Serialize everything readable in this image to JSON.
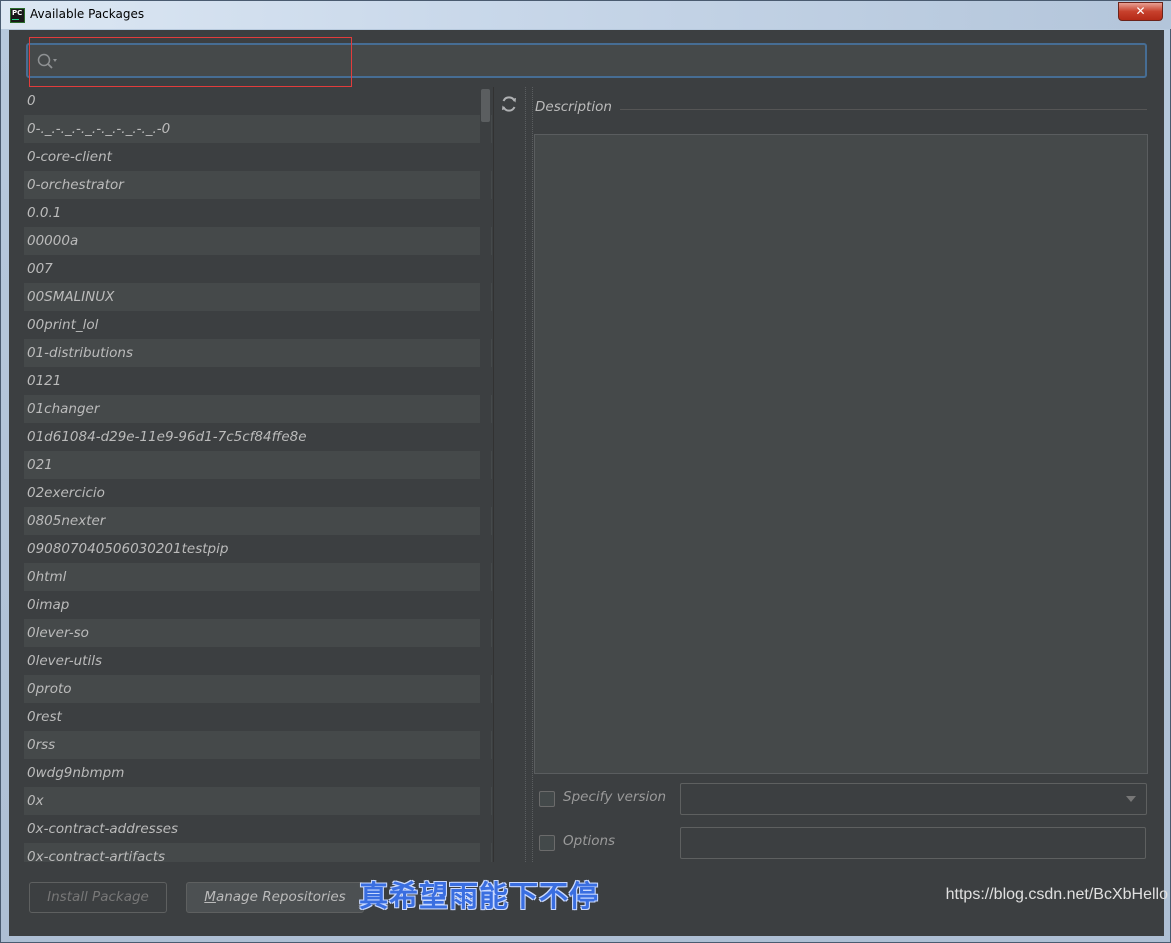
{
  "window": {
    "title": "Available Packages",
    "app_icon_text": "PC",
    "close_glyph": "✕"
  },
  "search": {
    "placeholder": "",
    "value": ""
  },
  "packages": [
    "0",
    "0-._.-._.-._.-._.-._.-._.-0",
    "0-core-client",
    "0-orchestrator",
    "0.0.1",
    "00000a",
    "007",
    "00SMALINUX",
    "00print_lol",
    "01-distributions",
    "0121",
    "01changer",
    "01d61084-d29e-11e9-96d1-7c5cf84ffe8e",
    "021",
    "02exercicio",
    "0805nexter",
    "090807040506030201testpip",
    "0html",
    "0imap",
    "0lever-so",
    "0lever-utils",
    "0proto",
    "0rest",
    "0rss",
    "0wdg9nbmpm",
    "0x",
    "0x-contract-addresses",
    "0x-contract-artifacts"
  ],
  "description": {
    "label": "Description",
    "text": ""
  },
  "options": {
    "specify_version_label": "Specify version",
    "options_label": "Options",
    "version_value": "",
    "options_value": ""
  },
  "buttons": {
    "install": "Install Package",
    "manage_mnemonic": "M",
    "manage_rest": "anage Repositories"
  },
  "overlay": {
    "caption": "真希望雨能下不停",
    "watermark": "https://blog.csdn.net/BcXbHello"
  },
  "colors": {
    "background": "#3c3f41",
    "row_alt": "#45494a",
    "focus_border": "#466d94",
    "text": "#bbbbbb"
  }
}
